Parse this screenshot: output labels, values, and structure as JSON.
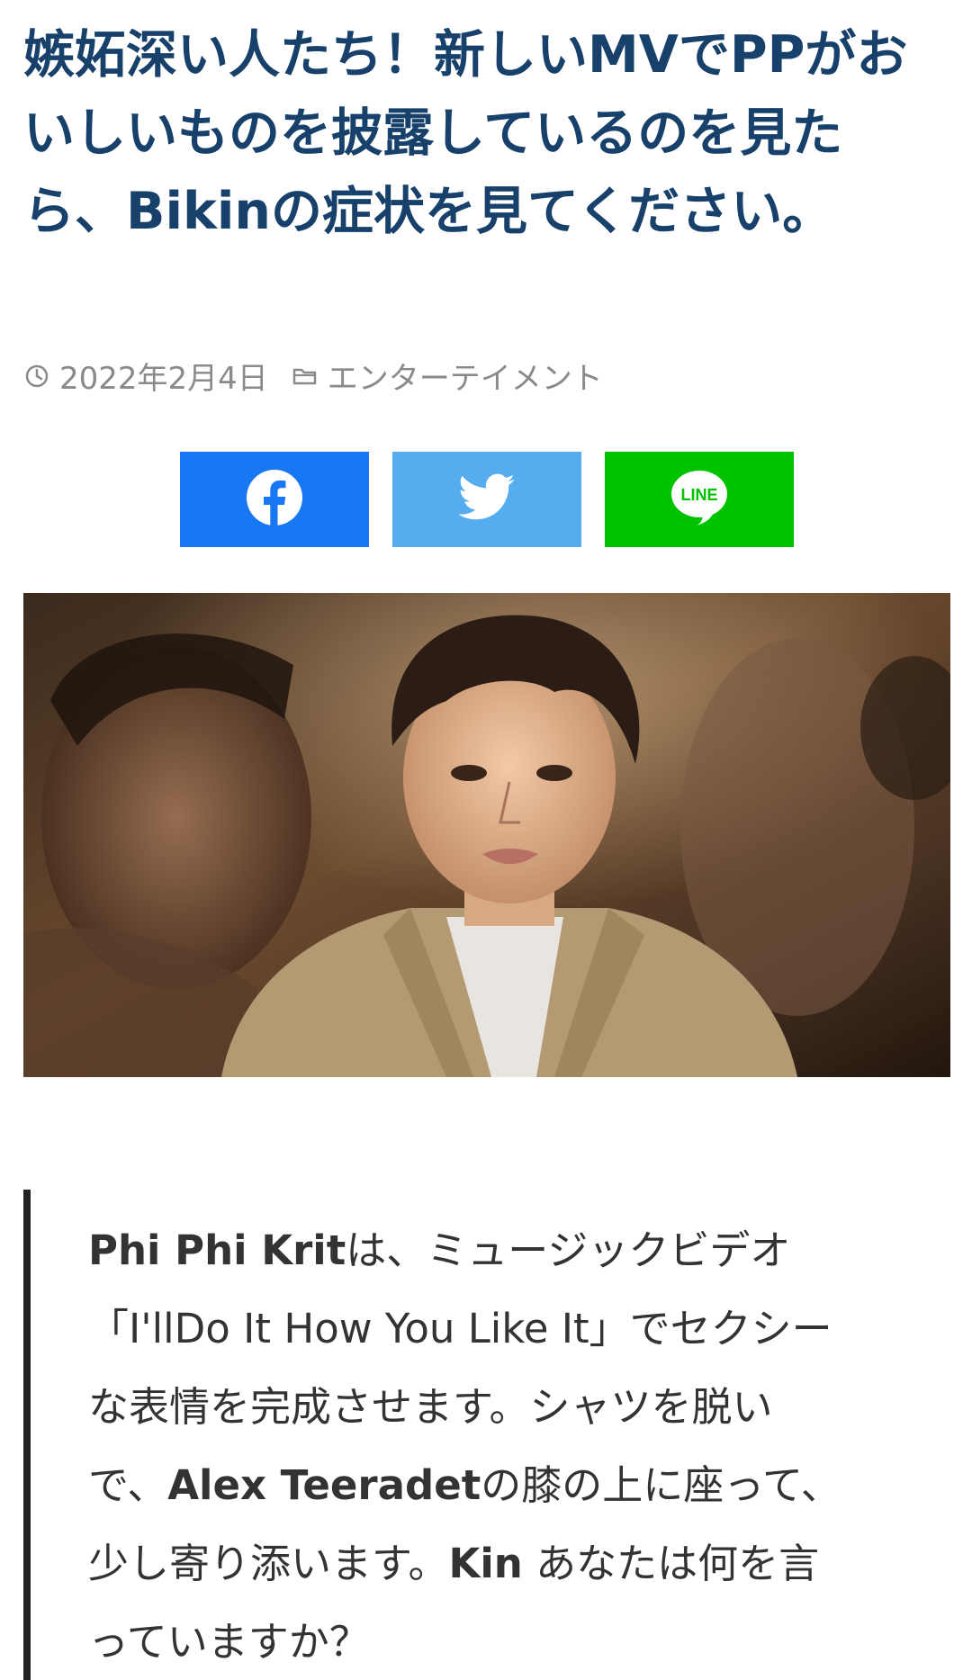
{
  "article": {
    "title": "嫉妬深い人たち！新しいMVでPPがおいしいものを披露しているのを見たら、Bikinの症状を見てください。",
    "date": "2022年2月4日",
    "category": "エンターテイメント"
  },
  "share": {
    "facebook_icon": "facebook-icon",
    "twitter_icon": "twitter-icon",
    "line_label": "LINE",
    "colors": {
      "facebook": "#1877f2",
      "twitter": "#55acee",
      "line": "#00c300"
    }
  },
  "body": {
    "subject": "Phi Phi Krit",
    "line1_rest": "は、ミュージックビデオ",
    "line2": "「I'llDo It How You Like It」でセクシー",
    "line3": "な表情を完成させます。シャツを脱い",
    "line4_a": "で、",
    "line4_name": "Alex Teeradet",
    "line4_b": "の膝の上に座って、",
    "line5_a": "少し寄り添います。",
    "line5_name": "Kin",
    "line5_b": " あなたは何を言",
    "line6": "っていますか？"
  },
  "colors": {
    "title": "#17416b",
    "meta": "#8a8a8a",
    "quote_border": "#222222"
  }
}
